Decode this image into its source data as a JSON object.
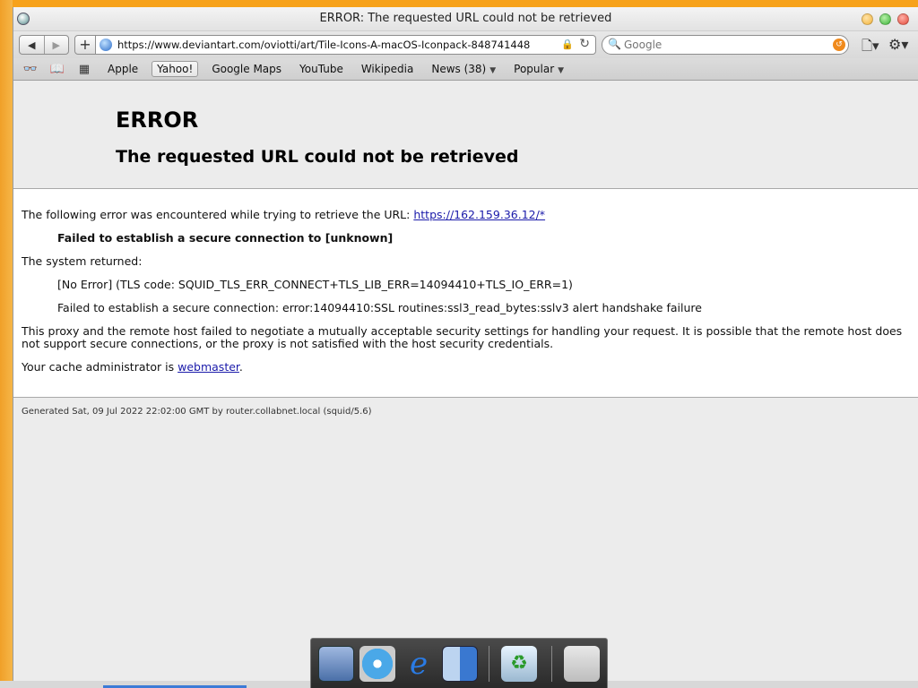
{
  "window": {
    "title": "ERROR: The requested URL could not be retrieved"
  },
  "toolbar": {
    "back_icon": "◀",
    "forward_icon": "▶",
    "add_icon": "+",
    "url": "https://www.deviantart.com/oviotti/art/Tile-Icons-A-macOS-Iconpack-848741448",
    "search_placeholder": "Google"
  },
  "bookmarks": {
    "items": [
      {
        "label": "Apple"
      },
      {
        "label": "Yahoo!"
      },
      {
        "label": "Google Maps"
      },
      {
        "label": "YouTube"
      },
      {
        "label": "Wikipedia"
      },
      {
        "label": "News (38)"
      },
      {
        "label": "Popular"
      }
    ]
  },
  "page": {
    "heading": "ERROR",
    "subheading": "The requested URL could not be retrieved",
    "intro_text": "The following error was encountered while trying to retrieve the URL: ",
    "intro_link": "https://162.159.36.12/*",
    "error_summary": "Failed to establish a secure connection to [unknown]",
    "system_returned": "The system returned:",
    "tls_code": "[No Error] (TLS code: SQUID_TLS_ERR_CONNECT+TLS_LIB_ERR=14094410+TLS_IO_ERR=1)",
    "ssl_error": "Failed to establish a secure connection: error:14094410:SSL routines:ssl3_read_bytes:sslv3 alert handshake failure",
    "explanation": "This proxy and the remote host failed to negotiate a mutually acceptable security settings for handling your request. It is possible that the remote host does not support secure connections, or the proxy is not satisfied with the host security credentials.",
    "admin_text": "Your cache administrator is ",
    "admin_link": "webmaster",
    "admin_suffix": ".",
    "footer": "Generated Sat, 09 Jul 2022 22:02:00 GMT by router.collabnet.local (squid/5.6)"
  },
  "colors": {
    "desktop": "#f59a14",
    "link": "#1a1aaa",
    "search_clear": "#f08a1c"
  }
}
